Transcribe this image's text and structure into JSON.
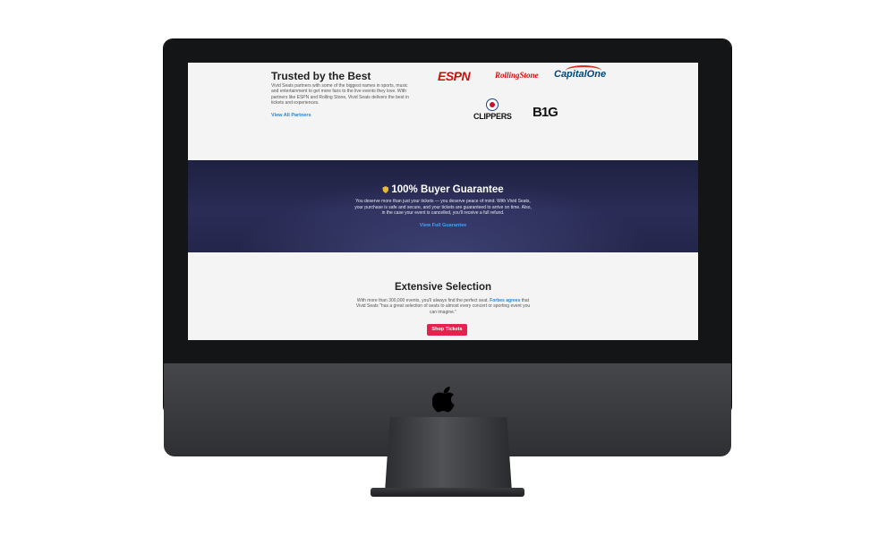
{
  "trusted": {
    "title": "Trusted by the Best",
    "text": "Vivid Seats partners with some of the biggest names in sports, music and entertainment to get more fans to the live events they love. With partners like ESPN and Rolling Stone, Vivid Seats delivers the best in tickets and experiences.",
    "link": "View All Partners",
    "logos": {
      "espn": "ESPN",
      "rolling_stone": "RollingStone",
      "capital_one": "CapitalOne",
      "clippers": "CLIPPERS",
      "big10": "B1G"
    }
  },
  "guarantee": {
    "title": "100% Buyer Guarantee",
    "text": "You deserve more than just your tickets — you deserve peace of mind. With Vivid Seats, your purchase is safe and secure, and your tickets are guaranteed to arrive on time. Also, in the case your event is cancelled, you'll receive a full refund.",
    "link": "View Full Guarantee"
  },
  "selection": {
    "title": "Extensive Selection",
    "text_before": "With more than 300,000 events, you'll always find the perfect seat. ",
    "forbes_link": "Forbes agrees",
    "text_after": " that Vivid Seats \"has a great selection of seats to almost every concert or sporting event you can imagine.\"",
    "button": "Shop Tickets"
  },
  "colors": {
    "accent_blue": "#1e88e5",
    "brand_red": "#e7204e",
    "banner_navy": "#23254a"
  },
  "icons": [
    "shield-icon",
    "apple-icon"
  ]
}
